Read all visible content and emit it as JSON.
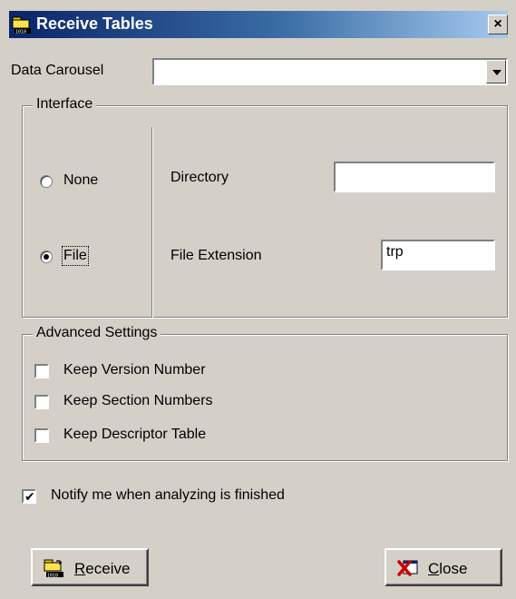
{
  "window": {
    "title": "Receive Tables",
    "close_glyph": "×"
  },
  "carousel": {
    "label": "Data Carousel",
    "value": ""
  },
  "interface": {
    "group_title": "Interface",
    "none_label": "None",
    "file_label": "File",
    "selected": "File",
    "directory_label": "Directory",
    "directory_value": "",
    "extension_label": "File Extension",
    "extension_value": "trp"
  },
  "advanced": {
    "group_title": "Advanced Settings",
    "options": [
      {
        "label": "Keep Version Number",
        "checked": false
      },
      {
        "label": "Keep Section Numbers",
        "checked": false
      },
      {
        "label": "Keep Descriptor Table",
        "checked": false
      }
    ]
  },
  "notify": {
    "label": "Notify me when analyzing is finished",
    "checked": true,
    "check_glyph": "✔"
  },
  "buttons": {
    "receive_label": "Receive",
    "close_label": "Close"
  },
  "icons": {
    "title_icon": "folder-binary-icon",
    "receive_icon": "folder-binary-icon",
    "close_icon": "red-x-window-icon",
    "dropdown_icon": "chevron-down-icon"
  }
}
